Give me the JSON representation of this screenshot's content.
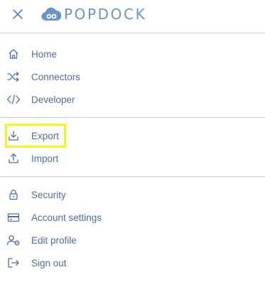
{
  "header": {
    "close_icon": "close-icon",
    "brand": "POPDOCK",
    "brand_color": "#6b94c4"
  },
  "menu": {
    "accent_color": "#4a6fa3",
    "group1": [
      {
        "label": "Home",
        "icon": "home-icon"
      },
      {
        "label": "Connectors",
        "icon": "shuffle-icon"
      },
      {
        "label": "Developer",
        "icon": "code-icon"
      }
    ],
    "group2": [
      {
        "label": "Export",
        "icon": "download-icon",
        "highlighted": true
      },
      {
        "label": "Import",
        "icon": "upload-icon"
      }
    ],
    "group3": [
      {
        "label": "Security",
        "icon": "lock-icon"
      },
      {
        "label": "Account settings",
        "icon": "credit-card-icon"
      },
      {
        "label": "Edit profile",
        "icon": "user-settings-icon"
      },
      {
        "label": "Sign out",
        "icon": "sign-out-icon"
      }
    ]
  },
  "highlight_color": "#f4f41f"
}
